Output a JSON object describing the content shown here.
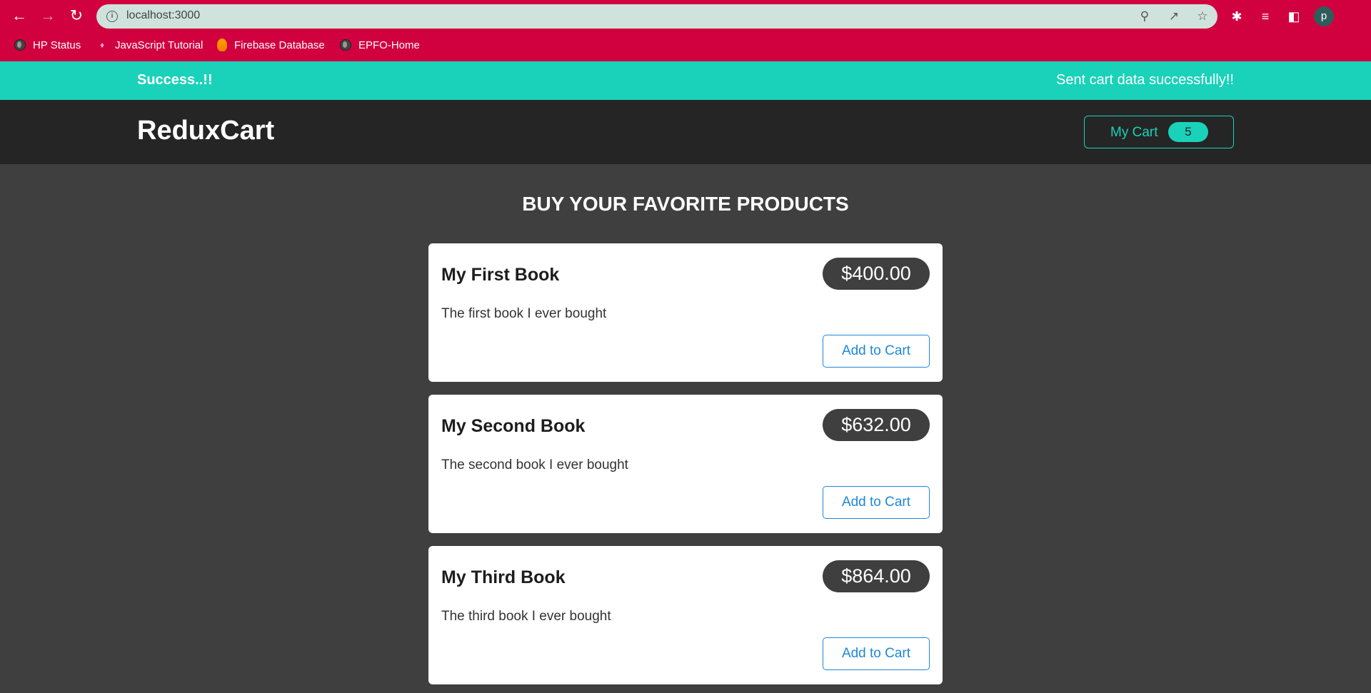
{
  "browser": {
    "url": "localhost:3000",
    "bookmarks": [
      {
        "label": "HP Status",
        "icon": "globe-icon"
      },
      {
        "label": "JavaScript Tutorial",
        "icon": "javascript-icon"
      },
      {
        "label": "Firebase Database",
        "icon": "firebase-icon"
      },
      {
        "label": "EPFO-Home",
        "icon": "globe-icon"
      }
    ],
    "profile_initial": "p",
    "colors": {
      "toolbar": "#d1003f",
      "omnibox": "#cfe3dc"
    }
  },
  "notification": {
    "title": "Success..!!",
    "message": "Sent cart data successfully!!",
    "color": "#1ad1b9"
  },
  "header": {
    "logo": "ReduxCart",
    "cart_label": "My Cart",
    "cart_count": "5"
  },
  "main": {
    "heading": "BUY YOUR FAVORITE PRODUCTS",
    "products": [
      {
        "title": "My First Book",
        "price": "$400.00",
        "description": "The first book I ever bought",
        "button": "Add to Cart"
      },
      {
        "title": "My Second Book",
        "price": "$632.00",
        "description": "The second book I ever bought",
        "button": "Add to Cart"
      },
      {
        "title": "My Third Book",
        "price": "$864.00",
        "description": "The third book I ever bought",
        "button": "Add to Cart"
      }
    ]
  },
  "colors": {
    "accent": "#1ad1b9",
    "header_bg": "#252525",
    "page_bg": "#3f3f3f",
    "button_blue": "#1e88d8"
  }
}
